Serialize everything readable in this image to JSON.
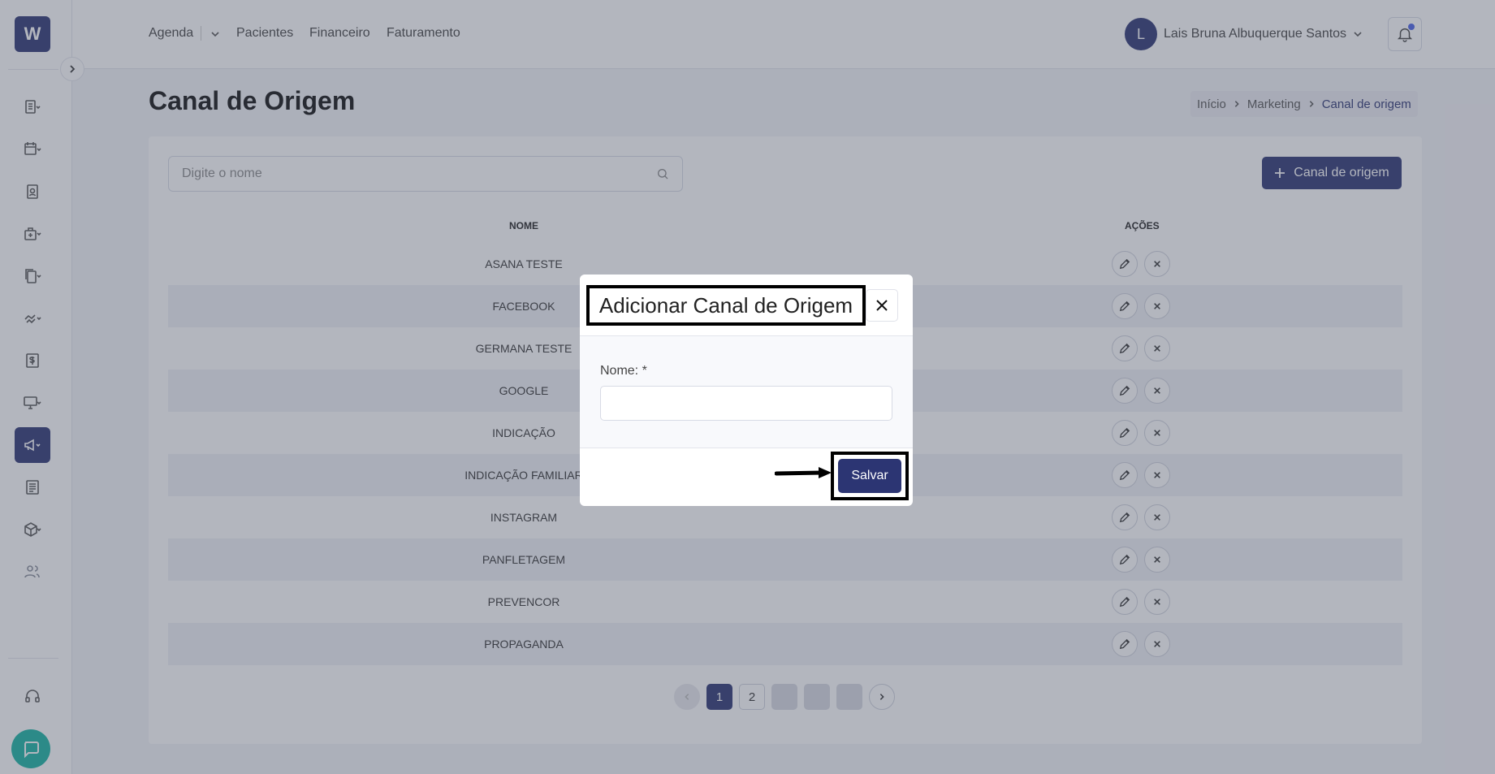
{
  "app": {
    "logo_letter": "W"
  },
  "nav": {
    "items": [
      "Agenda",
      "Pacientes",
      "Financeiro",
      "Faturamento"
    ]
  },
  "user": {
    "initial": "L",
    "name": "Lais Bruna Albuquerque Santos"
  },
  "page": {
    "title": "Canal de Origem"
  },
  "breadcrumb": [
    "Início",
    "Marketing",
    "Canal de origem"
  ],
  "search": {
    "placeholder": "Digite o nome",
    "value": ""
  },
  "add_button": {
    "label": "Canal de origem"
  },
  "table": {
    "headers": {
      "name": "NOME",
      "actions": "AÇÕES"
    },
    "rows": [
      "ASANA TESTE",
      "FACEBOOK",
      "GERMANA TESTE",
      "GOOGLE",
      "INDICAÇÃO",
      "INDICAÇÃO FAMILIAR",
      "INSTAGRAM",
      "PANFLETAGEM",
      "PREVENCOR",
      "PROPAGANDA"
    ]
  },
  "pagination": {
    "pages": [
      "1",
      "2"
    ],
    "current": "1"
  },
  "modal": {
    "title": "Adicionar Canal de Origem",
    "field_label": "Nome: *",
    "field_value": "",
    "save_label": "Salvar"
  },
  "colors": {
    "primary": "#2c3573",
    "chat": "#17b3a3",
    "notification": "#4a63e7"
  }
}
